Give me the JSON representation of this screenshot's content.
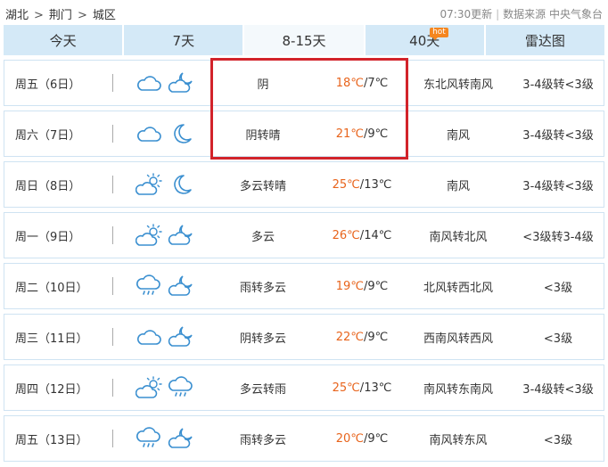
{
  "breadcrumb": {
    "province": "湖北",
    "city": "荆门",
    "district": "城区",
    "separator": ">"
  },
  "meta": {
    "update": "07:30更新",
    "divider": "|",
    "source": "数据来源 中央气象台"
  },
  "tabs": [
    {
      "label": "今天",
      "active": false
    },
    {
      "label": "7天",
      "active": false
    },
    {
      "label": "8-15天",
      "active": true
    },
    {
      "label": "40天",
      "active": false,
      "badge": "hot"
    },
    {
      "label": "雷达图",
      "active": false
    }
  ],
  "colors": {
    "tab_bg": "#d4e9f7",
    "tab_active_bg": "#f4f9fc",
    "high_temp": "#e8641c",
    "highlight_box": "#d2232a",
    "hot_badge": "#f5861f"
  },
  "forecast": [
    {
      "day": "周五（6日）",
      "icons": [
        "cloud-icon",
        "cloudy-night-icon"
      ],
      "condition": "阴",
      "high": "18℃",
      "slash": "/",
      "low": "7℃",
      "wind": "东北风转南风",
      "level": "3-4级转<3级"
    },
    {
      "day": "周六（7日）",
      "icons": [
        "cloud-icon",
        "moon-icon"
      ],
      "condition": "阴转晴",
      "high": "21℃",
      "slash": "/",
      "low": "9℃",
      "wind": "南风",
      "level": "3-4级转<3级"
    },
    {
      "day": "周日（8日）",
      "icons": [
        "partly-cloudy-day-icon",
        "moon-icon"
      ],
      "condition": "多云转晴",
      "high": "25℃",
      "slash": "/",
      "low": "13℃",
      "wind": "南风",
      "level": "3-4级转<3级"
    },
    {
      "day": "周一（9日）",
      "icons": [
        "partly-cloudy-day-icon",
        "cloudy-night-icon"
      ],
      "condition": "多云",
      "high": "26℃",
      "slash": "/",
      "low": "14℃",
      "wind": "南风转北风",
      "level": "<3级转3-4级"
    },
    {
      "day": "周二（10日）",
      "icons": [
        "rain-icon",
        "cloudy-night-icon"
      ],
      "condition": "雨转多云",
      "high": "19℃",
      "slash": "/",
      "low": "9℃",
      "wind": "北风转西北风",
      "level": "<3级"
    },
    {
      "day": "周三（11日）",
      "icons": [
        "cloud-icon",
        "cloudy-night-icon"
      ],
      "condition": "阴转多云",
      "high": "22℃",
      "slash": "/",
      "low": "9℃",
      "wind": "西南风转西风",
      "level": "<3级"
    },
    {
      "day": "周四（12日）",
      "icons": [
        "partly-cloudy-day-icon",
        "rain-icon"
      ],
      "condition": "多云转雨",
      "high": "25℃",
      "slash": "/",
      "low": "13℃",
      "wind": "南风转东南风",
      "level": "3-4级转<3级"
    },
    {
      "day": "周五（13日）",
      "icons": [
        "rain-icon",
        "cloudy-night-icon"
      ],
      "condition": "雨转多云",
      "high": "20℃",
      "slash": "/",
      "low": "9℃",
      "wind": "南风转东风",
      "level": "<3级"
    }
  ]
}
